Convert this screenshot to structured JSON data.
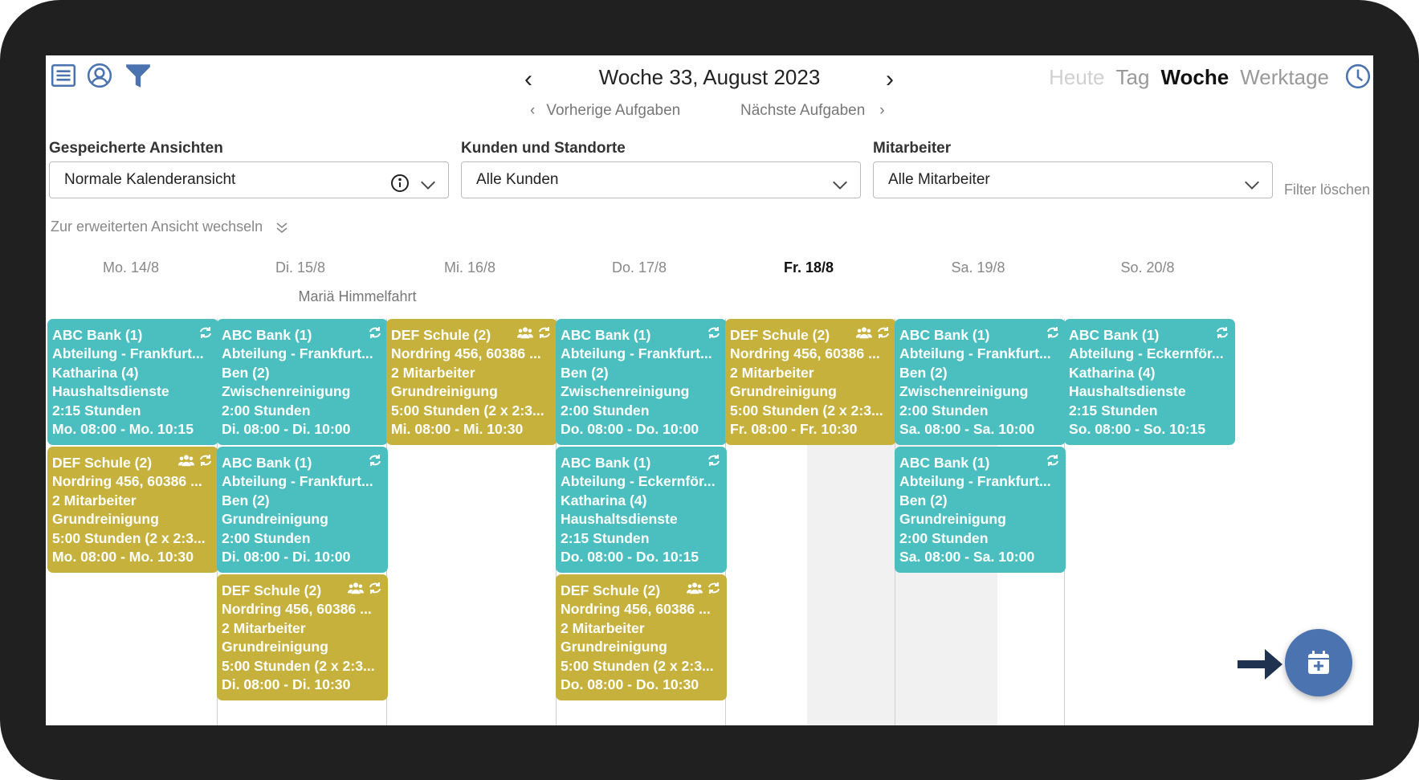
{
  "header": {
    "week_title": "Woche 33, August 2023",
    "prev_tasks": "Vorherige Aufgaben",
    "next_tasks": "Nächste Aufgaben",
    "views": [
      {
        "label": "Heute"
      },
      {
        "label": "Tag"
      },
      {
        "label": "Woche"
      },
      {
        "label": "Werktage"
      }
    ],
    "active_view": "Woche"
  },
  "filters": {
    "saved_views_label": "Gespeicherte Ansichten",
    "saved_views_value": "Normale Kalenderansicht",
    "customers_label": "Kunden und Standorte",
    "customers_value": "Alle Kunden",
    "employees_label": "Mitarbeiter",
    "employees_value": "Alle Mitarbeiter",
    "clear": "Filter löschen",
    "switch_view": "Zur erweiterten Ansicht wechseln"
  },
  "days": [
    {
      "label": "Mo. 14/8"
    },
    {
      "label": "Di. 15/8",
      "holiday": "Mariä Himmelfahrt"
    },
    {
      "label": "Mi. 16/8"
    },
    {
      "label": "Do. 17/8"
    },
    {
      "label": "Fr. 18/8",
      "today": true
    },
    {
      "label": "Sa. 19/8"
    },
    {
      "label": "So. 20/8"
    }
  ],
  "events": [
    {
      "day": 0,
      "slot": 0,
      "color": "teal",
      "team": false,
      "lines": [
        "ABC Bank (1)",
        "Abteilung - Frankfurt...",
        "Katharina (4)",
        "Haushaltsdienste",
        "2:15 Stunden",
        "Mo. 08:00 - Mo. 10:15"
      ]
    },
    {
      "day": 0,
      "slot": 1,
      "color": "olive",
      "team": true,
      "lines": [
        "DEF Schule (2)",
        "Nordring 456, 60386 ...",
        "2 Mitarbeiter",
        "Grundreinigung",
        "5:00 Stunden (2 x 2:3...",
        "Mo. 08:00 - Mo. 10:30"
      ]
    },
    {
      "day": 1,
      "slot": 0,
      "color": "teal",
      "team": false,
      "lines": [
        "ABC Bank (1)",
        "Abteilung - Frankfurt...",
        "Ben (2)",
        "Zwischenreinigung",
        "2:00 Stunden",
        "Di. 08:00 - Di. 10:00"
      ]
    },
    {
      "day": 1,
      "slot": 1,
      "color": "teal",
      "team": false,
      "lines": [
        "ABC Bank (1)",
        "Abteilung - Frankfurt...",
        "Ben (2)",
        "Grundreinigung",
        "2:00 Stunden",
        "Di. 08:00 - Di. 10:00"
      ]
    },
    {
      "day": 1,
      "slot": 2,
      "color": "olive",
      "team": true,
      "lines": [
        "DEF Schule (2)",
        "Nordring 456, 60386 ...",
        "2 Mitarbeiter",
        "Grundreinigung",
        "5:00 Stunden (2 x 2:3...",
        "Di. 08:00 - Di. 10:30"
      ]
    },
    {
      "day": 2,
      "slot": 0,
      "color": "olive",
      "team": true,
      "lines": [
        "DEF Schule (2)",
        "Nordring 456, 60386 ...",
        "2 Mitarbeiter",
        "Grundreinigung",
        "5:00 Stunden (2 x 2:3...",
        "Mi. 08:00 - Mi. 10:30"
      ]
    },
    {
      "day": 3,
      "slot": 0,
      "color": "teal",
      "team": false,
      "lines": [
        "ABC Bank (1)",
        "Abteilung - Frankfurt...",
        "Ben (2)",
        "Zwischenreinigung",
        "2:00 Stunden",
        "Do. 08:00 - Do. 10:00"
      ]
    },
    {
      "day": 3,
      "slot": 1,
      "color": "teal",
      "team": false,
      "lines": [
        "ABC Bank (1)",
        "Abteilung - Eckernför...",
        "Katharina (4)",
        "Haushaltsdienste",
        "2:15 Stunden",
        "Do. 08:00 - Do. 10:15"
      ]
    },
    {
      "day": 3,
      "slot": 2,
      "color": "olive",
      "team": true,
      "lines": [
        "DEF Schule (2)",
        "Nordring 456, 60386 ...",
        "2 Mitarbeiter",
        "Grundreinigung",
        "5:00 Stunden (2 x 2:3...",
        "Do. 08:00 - Do. 10:30"
      ]
    },
    {
      "day": 4,
      "slot": 0,
      "color": "olive",
      "team": true,
      "lines": [
        "DEF Schule (2)",
        "Nordring 456, 60386 ...",
        "2 Mitarbeiter",
        "Grundreinigung",
        "5:00 Stunden (2 x 2:3...",
        "Fr. 08:00 - Fr. 10:30"
      ]
    },
    {
      "day": 5,
      "slot": 0,
      "color": "teal",
      "team": false,
      "lines": [
        "ABC Bank (1)",
        "Abteilung - Frankfurt...",
        "Ben (2)",
        "Zwischenreinigung",
        "2:00 Stunden",
        "Sa. 08:00 - Sa. 10:00"
      ]
    },
    {
      "day": 5,
      "slot": 1,
      "color": "teal",
      "team": false,
      "lines": [
        "ABC Bank (1)",
        "Abteilung - Frankfurt...",
        "Ben (2)",
        "Grundreinigung",
        "2:00 Stunden",
        "Sa. 08:00 - Sa. 10:00"
      ]
    },
    {
      "day": 6,
      "slot": 0,
      "color": "teal",
      "team": false,
      "lines": [
        "ABC Bank (1)",
        "Abteilung - Eckernför...",
        "Katharina (4)",
        "Haushaltsdienste",
        "2:15 Stunden",
        "So. 08:00 - So. 10:15"
      ]
    }
  ],
  "colors": {
    "teal": "#4bbfc0",
    "olive": "#c7b13d",
    "accent": "#4a73b0",
    "arrow": "#1f3350"
  },
  "icons": [
    "menu-icon",
    "user-icon",
    "filter-icon",
    "clock-icon",
    "info-icon",
    "chevron-down-icon",
    "repeat-icon",
    "group-icon",
    "calendar-plus-icon",
    "arrow-right-icon"
  ]
}
